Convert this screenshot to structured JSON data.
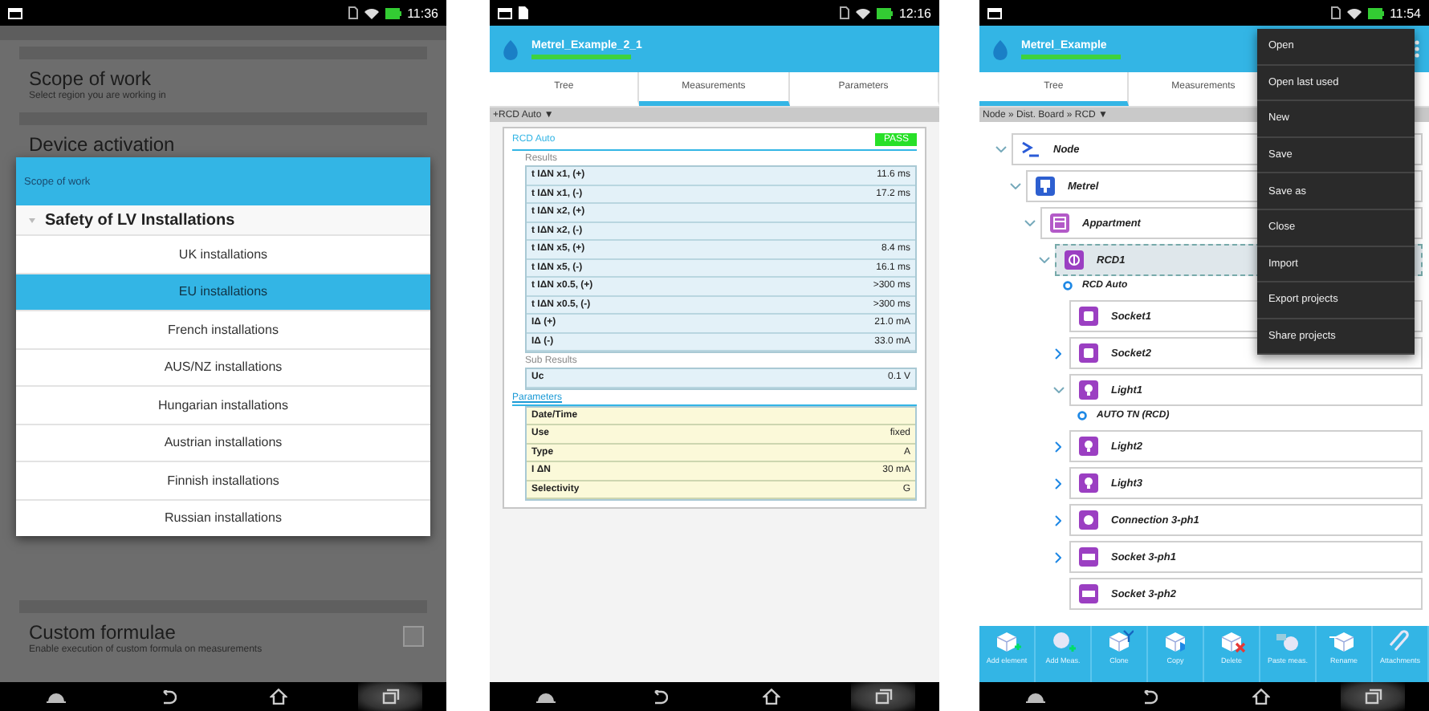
{
  "settings_screen": {
    "time": "11:36",
    "settings": [
      {
        "title": "Scope of work",
        "subtitle": "Select region you are working in"
      },
      {
        "title": "Device activation"
      }
    ],
    "bottom_setting": {
      "title": "Custom formulae",
      "subtitle": "Enable execution of custom formula on measurements",
      "checked": false
    },
    "dialog": {
      "title": "Scope of work",
      "group": "Safety of LV Installations",
      "options": [
        {
          "label": "UK installations",
          "selected": false
        },
        {
          "label": "EU installations",
          "selected": true
        },
        {
          "label": "French  installations",
          "selected": false
        },
        {
          "label": "AUS/NZ installations",
          "selected": false
        },
        {
          "label": "Hungarian installations",
          "selected": false
        },
        {
          "label": "Austrian installations",
          "selected": false
        },
        {
          "label": "Finnish installations",
          "selected": false
        },
        {
          "label": "Russian installations",
          "selected": false
        }
      ]
    }
  },
  "measurement_screen": {
    "time": "12:16",
    "app_title": "Metrel_Example_2_1",
    "tabs": [
      {
        "label": "Tree",
        "selected": false
      },
      {
        "label": "Measurements",
        "selected": true
      },
      {
        "label": "Parameters",
        "selected": false
      }
    ],
    "breadcrumb": "+RCD Auto ▼",
    "card": {
      "title": "RCD Auto",
      "status": "PASS",
      "sections": [
        {
          "title": "Results",
          "kind": "results",
          "rows": [
            {
              "label": "t IΔN x1, (+)",
              "value": "11.6 ms"
            },
            {
              "label": "t IΔN x1, (-)",
              "value": "17.2 ms"
            },
            {
              "label": "t IΔN x2, (+)"
            },
            {
              "label": "t IΔN x2, (-)"
            },
            {
              "label": "t IΔN x5, (+)",
              "value": "8.4 ms"
            },
            {
              "label": "t IΔN x5, (-)",
              "value": "16.1 ms"
            },
            {
              "label": "t IΔN x0.5, (+)",
              "value": ">300 ms"
            },
            {
              "label": "t IΔN x0.5, (-)",
              "value": ">300 ms"
            },
            {
              "label": "IΔ (+)",
              "value": "21.0 mA"
            },
            {
              "label": "IΔ (-)",
              "value": "33.0 mA"
            }
          ]
        },
        {
          "title": "Sub Results",
          "kind": "results",
          "rows": [
            {
              "label": "Uc",
              "value": "0.1 V"
            }
          ]
        },
        {
          "title": "Parameters",
          "kind": "parameters",
          "rows": [
            {
              "label": "Date/Time"
            },
            {
              "label": "Use",
              "value": "fixed"
            },
            {
              "label": "Type",
              "value": "A"
            },
            {
              "label": "I ΔN",
              "value": "30 mA"
            },
            {
              "label": "Selectivity",
              "value": "G"
            }
          ]
        }
      ]
    }
  },
  "tree_screen": {
    "time": "11:54",
    "app_title": "Metrel_Example",
    "tabs": [
      {
        "label": "Tree",
        "selected": true
      },
      {
        "label": "Measurements",
        "selected": false
      }
    ],
    "breadcrumb": "Node » Dist. Board » RCD ▼",
    "tree": [
      {
        "label": "Node",
        "kind": "node",
        "expandable": true,
        "expanded": true,
        "selected": false,
        "children": [
          {
            "label": "Metrel",
            "kind": "instrument",
            "expandable": true,
            "expanded": true,
            "selected": false,
            "children": [
              {
                "label": "Appartment",
                "kind": "board",
                "expandable": true,
                "expanded": true,
                "selected": false,
                "children": [
                  {
                    "label": "RCD1",
                    "kind": "rcd",
                    "expandable": true,
                    "expanded": true,
                    "selected": true,
                    "children": [
                      {
                        "label": "RCD Auto",
                        "kind": "measurement"
                      },
                      {
                        "label": "Socket1",
                        "kind": "socket",
                        "expandable": false,
                        "selected": false
                      },
                      {
                        "label": "Socket2",
                        "kind": "socket",
                        "expandable": true,
                        "expanded": false,
                        "selected": false
                      },
                      {
                        "label": "Light1",
                        "kind": "light",
                        "expandable": true,
                        "expanded": true,
                        "selected": false,
                        "children": [
                          {
                            "label": "AUTO TN (RCD)",
                            "kind": "measurement"
                          }
                        ]
                      },
                      {
                        "label": "Light2",
                        "kind": "light",
                        "expandable": true,
                        "expanded": false,
                        "selected": false
                      },
                      {
                        "label": "Light3",
                        "kind": "light",
                        "expandable": true,
                        "expanded": false,
                        "selected": false
                      },
                      {
                        "label": "Connection 3-ph1",
                        "kind": "connection",
                        "expandable": true,
                        "expanded": false,
                        "selected": false
                      },
                      {
                        "label": "Socket 3-ph1",
                        "kind": "socket3",
                        "expandable": true,
                        "expanded": false,
                        "selected": false
                      },
                      {
                        "label": "Socket 3-ph2",
                        "kind": "socket3",
                        "expandable": false,
                        "selected": false
                      }
                    ]
                  }
                ]
              }
            ]
          }
        ]
      }
    ],
    "menu": [
      "Open",
      "Open last used",
      "New",
      "Save",
      "Save as",
      "Close",
      "Import",
      "Export projects",
      "Share projects"
    ],
    "toolbar": [
      {
        "label": "Add element",
        "kind": "add-element"
      },
      {
        "label": "Add Meas.",
        "kind": "add-meas"
      },
      {
        "label": "Clone",
        "kind": "clone"
      },
      {
        "label": "Copy",
        "kind": "copy"
      },
      {
        "label": "Delete",
        "kind": "delete"
      },
      {
        "label": "Paste meas.",
        "kind": "paste"
      },
      {
        "label": "Rename",
        "kind": "rename"
      },
      {
        "label": "Attachments",
        "kind": "attach"
      }
    ]
  }
}
